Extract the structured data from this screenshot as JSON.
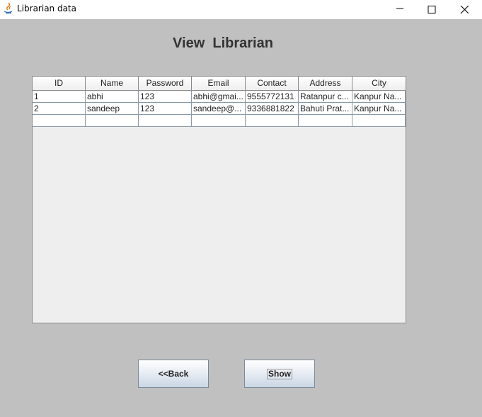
{
  "window": {
    "title": "Librarian data",
    "icons": [
      "java-icon",
      "minimize-icon",
      "maximize-icon",
      "close-icon"
    ]
  },
  "heading": "View  Librarian",
  "table": {
    "columns": [
      "ID",
      "Name",
      "Password",
      "Email",
      "Contact",
      "Address",
      "City"
    ],
    "rows": [
      [
        "1",
        "abhi",
        "123",
        "abhi@gmai...",
        "9555772131",
        "Ratanpur c...",
        "Kanpur Na..."
      ],
      [
        "2",
        "sandeep",
        "123",
        "sandeep@...",
        "9336881822",
        "Bahuti Prat...",
        "Kanpur Na..."
      ],
      [
        "",
        "",
        "",
        "",
        "",
        "",
        ""
      ]
    ]
  },
  "buttons": {
    "back_label": "<<Back",
    "show_label": "Show"
  }
}
